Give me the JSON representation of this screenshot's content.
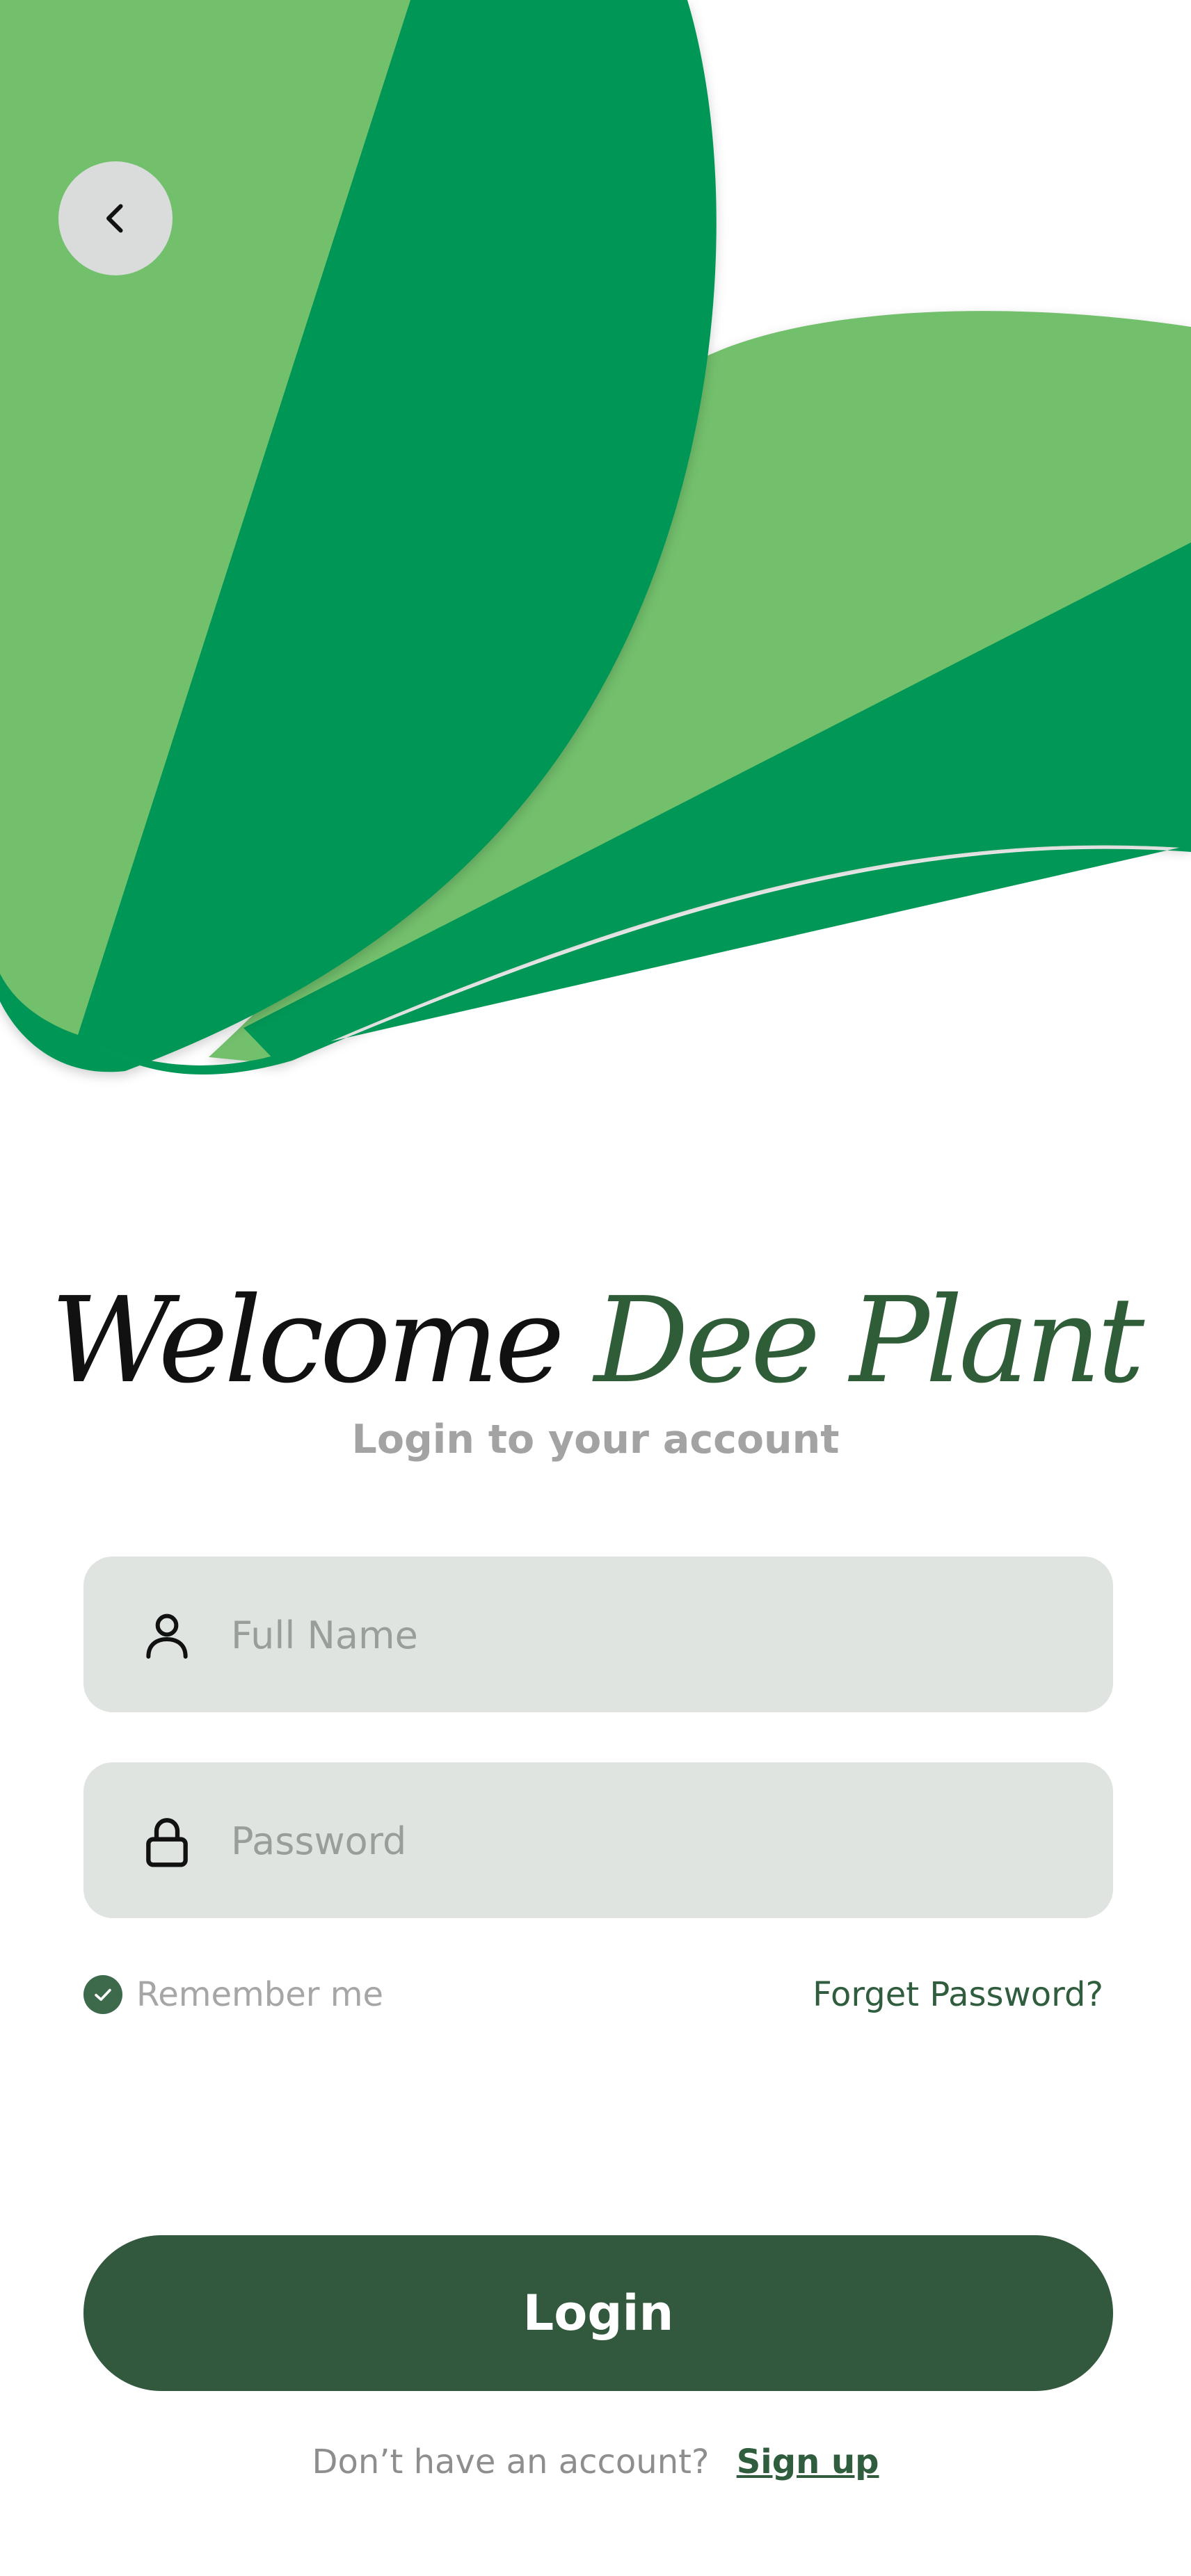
{
  "header": {
    "back_icon": "chevron-left-icon"
  },
  "hero": {
    "shapes": "leaf-illustration",
    "colors": {
      "light_green": "#72bf6c",
      "dark_green": "#019756"
    }
  },
  "welcome": {
    "word1": "Welcome",
    "word2": "Dee Plant",
    "subtitle": "Login to your account"
  },
  "form": {
    "full_name": {
      "placeholder": "Full Name",
      "value": "",
      "icon": "user-icon"
    },
    "password": {
      "placeholder": "Password",
      "value": "",
      "icon": "lock-icon"
    },
    "remember_me": {
      "label": "Remember me",
      "checked": true
    },
    "forget_password": "Forget Password?"
  },
  "actions": {
    "login_label": "Login"
  },
  "footer": {
    "question": "Don’t have an account?",
    "signup_label": "Sign up"
  },
  "colors": {
    "primary": "#32583e",
    "field_bg": "#e0e4e1",
    "muted_text": "#a3a3a3"
  }
}
